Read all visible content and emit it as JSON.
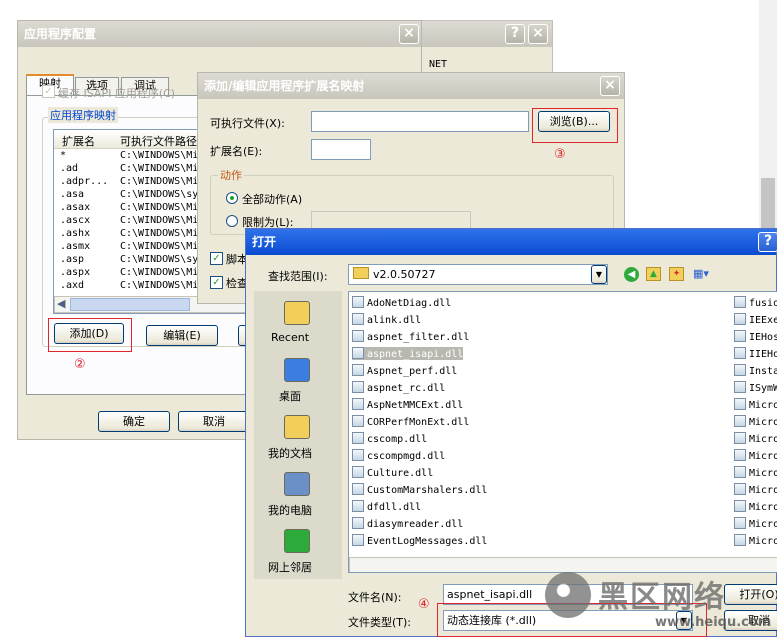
{
  "app_config": {
    "title": "应用程序配置",
    "tabs": [
      "映射",
      "选项",
      "调试"
    ],
    "cache_label": "缓存 ISAPI 应用程序(C)",
    "group_label": "应用程序映射",
    "columns": [
      "扩展名",
      "可执行文件路径"
    ],
    "rows": [
      {
        "ext": "*",
        "path": "C:\\WINDOWS\\Mi"
      },
      {
        "ext": ".ad",
        "path": "C:\\WINDOWS\\Mi"
      },
      {
        "ext": ".adpr...",
        "path": "C:\\WINDOWS\\Mi"
      },
      {
        "ext": ".asa",
        "path": "C:\\WINDOWS\\sy"
      },
      {
        "ext": ".asax",
        "path": "C:\\WINDOWS\\Mi"
      },
      {
        "ext": ".ascx",
        "path": "C:\\WINDOWS\\Mi"
      },
      {
        "ext": ".ashx",
        "path": "C:\\WINDOWS\\Mi"
      },
      {
        "ext": ".asmx",
        "path": "C:\\WINDOWS\\Mi"
      },
      {
        "ext": ".asp",
        "path": "C:\\WINDOWS\\sy"
      },
      {
        "ext": ".aspx",
        "path": "C:\\WINDOWS\\Mi"
      },
      {
        "ext": ".axd",
        "path": "C:\\WINDOWS\\Mi"
      }
    ],
    "add_button": "添加(D)",
    "edit_button": "编辑(E)",
    "ok_button": "确定",
    "cancel_button": "取消",
    "annotation": "②"
  },
  "back_window": {
    "title_fragment": "NET"
  },
  "ext_dialog": {
    "title": "添加/编辑应用程序扩展名映射",
    "exe_label": "可执行文件(X):",
    "exe_value": "",
    "browse_button": "浏览(B)...",
    "ext_label": "扩展名(E):",
    "ext_value": "",
    "actions_group": "动作",
    "all_actions": "全部动作(A)",
    "limit_to": "限制为(L):",
    "script_engine_partial": "脚本",
    "check_file_partial": "检查",
    "annotation": "③"
  },
  "open_dialog": {
    "title": "打开",
    "lookin_label": "查找范围(I):",
    "lookin_value": "v2.0.50727",
    "places": [
      "Recent",
      "桌面",
      "我的文档",
      "我的电脑",
      "网上邻居"
    ],
    "files": [
      "AdoNetDiag.dll",
      "alink.dll",
      "aspnet_filter.dll",
      "aspnet_isapi.dll",
      "Aspnet_perf.dll",
      "aspnet_rc.dll",
      "AspNetMMCExt.dll",
      "CORPerfMonExt.dll",
      "cscomp.dll",
      "cscompmgd.dll",
      "Culture.dll",
      "CustomMarshalers.dll",
      "dfdll.dll",
      "diasymreader.dll",
      "EventLogMessages.dll"
    ],
    "selected_file": "aspnet_isapi.dll",
    "files_col2": [
      "fusio",
      "IEExe",
      "IEHos",
      "IIEHo",
      "Insta",
      "ISymW",
      "Micro",
      "Micro",
      "Micro",
      "Micro",
      "Micro",
      "Micro",
      "Micro",
      "Micro",
      "Micro"
    ],
    "filename_label": "文件名(N):",
    "filename_value": "aspnet_isapi.dll",
    "filetype_label": "文件类型(T):",
    "filetype_value": "动态连接库 (*.dll)",
    "open_button": "打开(O)",
    "cancel_button": "取消",
    "annotation": "④"
  },
  "watermark": {
    "brand": "黑区网络",
    "url": "www.heiqu.com"
  }
}
